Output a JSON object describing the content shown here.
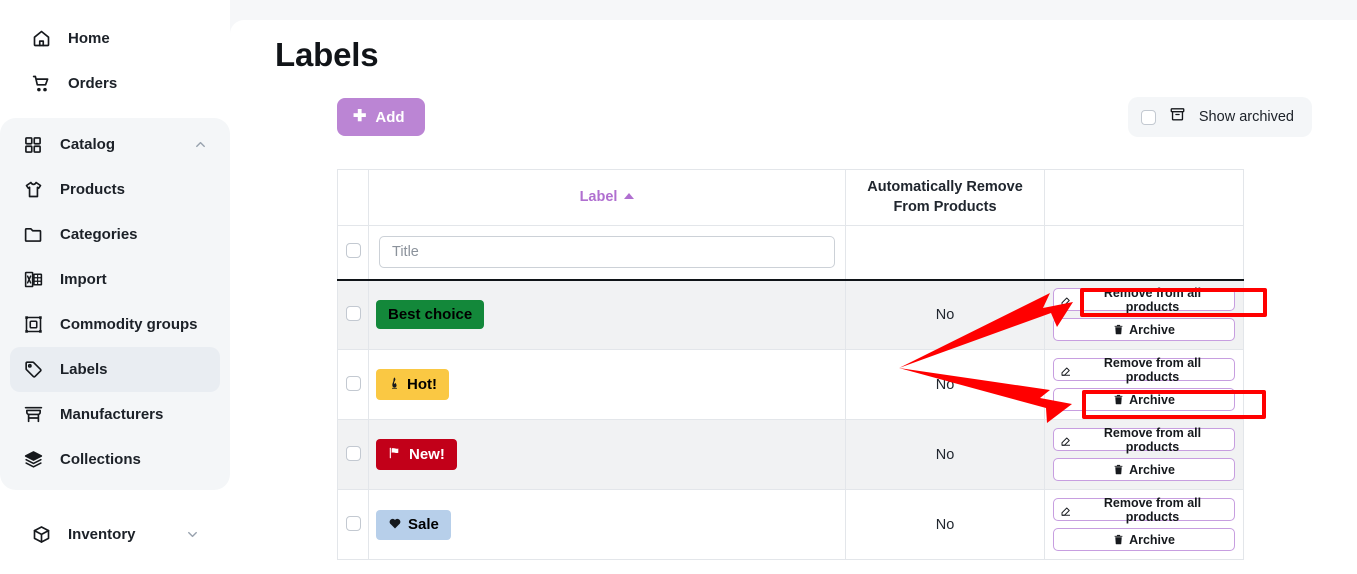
{
  "sidebar": {
    "top_items": [
      {
        "label": "Home",
        "icon": "home-icon"
      },
      {
        "label": "Orders",
        "icon": "cart-icon"
      }
    ],
    "group": {
      "header": {
        "label": "Catalog",
        "icon": "grid-icon",
        "chevron": "chevron-up-icon"
      },
      "items": [
        {
          "label": "Products",
          "icon": "tshirt-icon",
          "active": false
        },
        {
          "label": "Categories",
          "icon": "folder-icon",
          "active": false
        },
        {
          "label": "Import",
          "icon": "file-excel-icon",
          "active": false
        },
        {
          "label": "Commodity groups",
          "icon": "commodity-group-icon",
          "active": false
        },
        {
          "label": "Labels",
          "icon": "tag-icon",
          "active": true
        },
        {
          "label": "Manufacturers",
          "icon": "store-icon",
          "active": false
        },
        {
          "label": "Collections",
          "icon": "layers-icon",
          "active": false
        }
      ]
    },
    "bottom_items": [
      {
        "label": "Inventory",
        "icon": "box-icon",
        "chevron": "chevron-down-icon"
      }
    ]
  },
  "page": {
    "title": "Labels"
  },
  "toolbar": {
    "add_label": "Add",
    "add_icon": "plus-icon",
    "add_color": "#bb85d4",
    "show_archived_label": "Show archived",
    "show_archived_icon": "archive-box-icon",
    "show_archived_checked": false
  },
  "table": {
    "headers": {
      "checkbox": "",
      "label": "Label",
      "label_sort": "ascending",
      "auto_remove": "Automatically Remove From Products",
      "actions": ""
    },
    "filter_row": {
      "title_placeholder": "Title",
      "title_value": ""
    },
    "actions": {
      "remove_label": "Remove from all products",
      "remove_icon": "eraser-icon",
      "archive_label": "Archive",
      "archive_icon": "trash-icon"
    },
    "rows": [
      {
        "badge_text": "Best choice",
        "badge_icon": "",
        "badge_bg": "#13883a",
        "badge_fg": "#000000",
        "auto_remove": "No"
      },
      {
        "badge_text": "Hot!",
        "badge_icon": "flame-icon",
        "badge_bg": "#fac843",
        "badge_fg": "#000000",
        "auto_remove": "No"
      },
      {
        "badge_text": "New!",
        "badge_icon": "flag-icon",
        "badge_bg": "#c20019",
        "badge_fg": "#ffffff",
        "auto_remove": "No"
      },
      {
        "badge_text": "Sale",
        "badge_icon": "heart-icon",
        "badge_bg": "#b7cfea",
        "badge_fg": "#000000",
        "auto_remove": "No"
      }
    ]
  },
  "annotations": {
    "color": "#ff0000",
    "highlight_1": "Remove from all products (row 1)",
    "highlight_2": "Archive (row 2)"
  }
}
